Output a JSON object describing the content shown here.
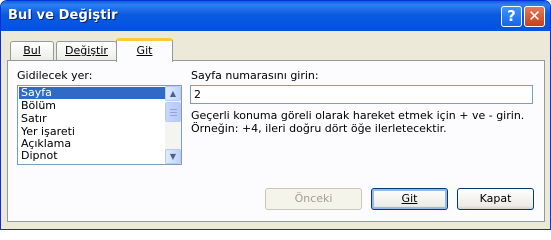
{
  "window": {
    "title": "Bul ve Değiştir",
    "help_label": "?",
    "close_label": "✕"
  },
  "tabs": [
    {
      "label": "Bul",
      "active": false
    },
    {
      "label": "Değiştir",
      "active": false
    },
    {
      "label": "Git",
      "active": true
    }
  ],
  "goto_what": {
    "label": "Gidilecek yer:",
    "items": [
      "Sayfa",
      "Bölüm",
      "Satır",
      "Yer işareti",
      "Açıklama",
      "Dipnot"
    ],
    "selected": "Sayfa"
  },
  "page_number": {
    "label": "Sayfa numarasını girin:",
    "value": "2",
    "hint": "Geçerli konuma göreli olarak hareket etmek için + ve - girin. Örneğin: +4, ileri doğru dört öğe ilerletecektir."
  },
  "buttons": {
    "previous": "Önceki",
    "goto": "Git",
    "close": "Kapat"
  },
  "colors": {
    "titlebar": "#0A5EDC",
    "selection": "#316AC5",
    "dialog_bg": "#ECE9D8",
    "tab_accent": "#FFC83C"
  }
}
